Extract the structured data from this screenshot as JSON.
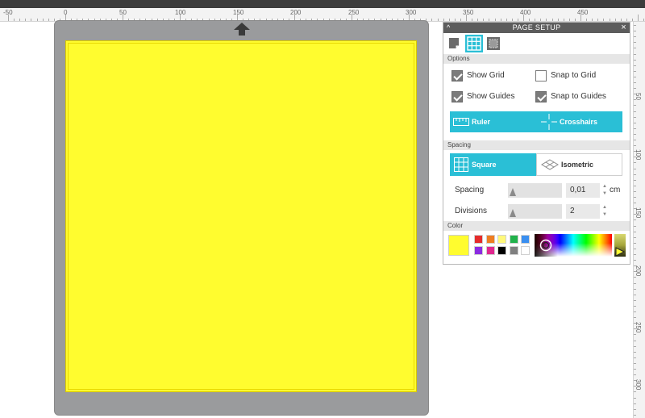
{
  "ruler": {
    "h_labels": [
      "-50",
      "0",
      "50",
      "100",
      "150",
      "200",
      "250",
      "300",
      "350",
      "400",
      "450"
    ],
    "v_labels": [
      "50",
      "100",
      "150",
      "200",
      "250",
      "300"
    ]
  },
  "panel": {
    "title": "PAGE SETUP",
    "close": "×",
    "collapse": "^",
    "tabs": [
      {
        "icon": "page-icon"
      },
      {
        "icon": "grid-icon"
      },
      {
        "icon": "cut-border-icon"
      }
    ],
    "options": {
      "header": "Options",
      "show_grid": {
        "label": "Show Grid",
        "checked": true
      },
      "snap_to_grid": {
        "label": "Snap to Grid",
        "checked": false
      },
      "show_guides": {
        "label": "Show Guides",
        "checked": true
      },
      "snap_to_guides": {
        "label": "Snap to Guides",
        "checked": true
      },
      "ruler_label": "Ruler",
      "crosshairs_label": "Crosshairs"
    },
    "spacing": {
      "header": "Spacing",
      "square_label": "Square",
      "isometric_label": "Isometric",
      "spacing_label": "Spacing",
      "spacing_value": "0,01",
      "spacing_unit": "cm",
      "divisions_label": "Divisions",
      "divisions_value": "2"
    },
    "color": {
      "header": "Color",
      "current": "#fffc2f",
      "swatches_row1": [
        "#e52b2b",
        "#ee7d22",
        "#fff87a",
        "#21b24b",
        "#3a8ff0"
      ],
      "swatches_row2": [
        "#8b2be2",
        "#e0288f",
        "#000000",
        "#7f7f7f",
        "#ffffff"
      ]
    }
  },
  "mat": {
    "paper_color": "#fffc2f"
  }
}
